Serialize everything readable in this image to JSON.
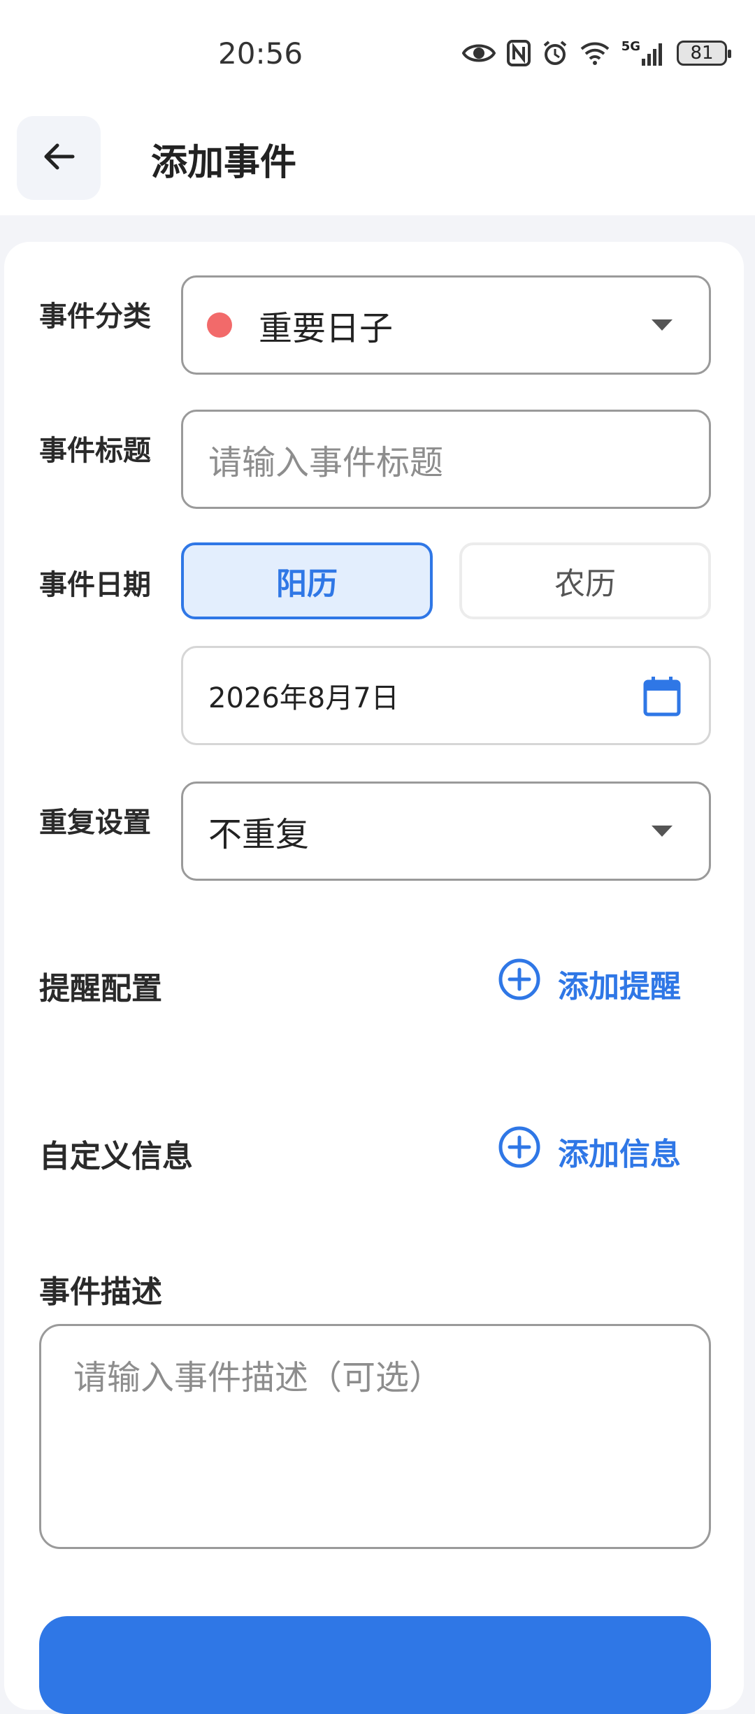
{
  "status_bar": {
    "time": "20:56",
    "network_label": "5G",
    "battery": "81",
    "icons": [
      "eye-icon",
      "nfc-icon",
      "alarm-icon",
      "wifi-icon",
      "signal-icon",
      "battery-icon"
    ]
  },
  "header": {
    "title": "添加事件",
    "back_icon": "arrow-left-icon"
  },
  "form": {
    "category": {
      "label": "事件分类",
      "value": "重要日子",
      "dot_color": "#f26a6a"
    },
    "title": {
      "label": "事件标题",
      "placeholder": "请输入事件标题"
    },
    "date": {
      "label": "事件日期",
      "solar": "阳历",
      "lunar": "农历",
      "selected": "阳历",
      "value": "2026年8月7日"
    },
    "repeat": {
      "label": "重复设置",
      "value": "不重复"
    },
    "reminder": {
      "label": "提醒配置",
      "add_label": "添加提醒"
    },
    "custom_info": {
      "label": "自定义信息",
      "add_label": "添加信息"
    },
    "description": {
      "label": "事件描述",
      "placeholder": "请输入事件描述（可选）"
    }
  },
  "colors": {
    "accent": "#2f77e6",
    "accent_light": "#e3eefd",
    "background": "#f3f4f8"
  }
}
